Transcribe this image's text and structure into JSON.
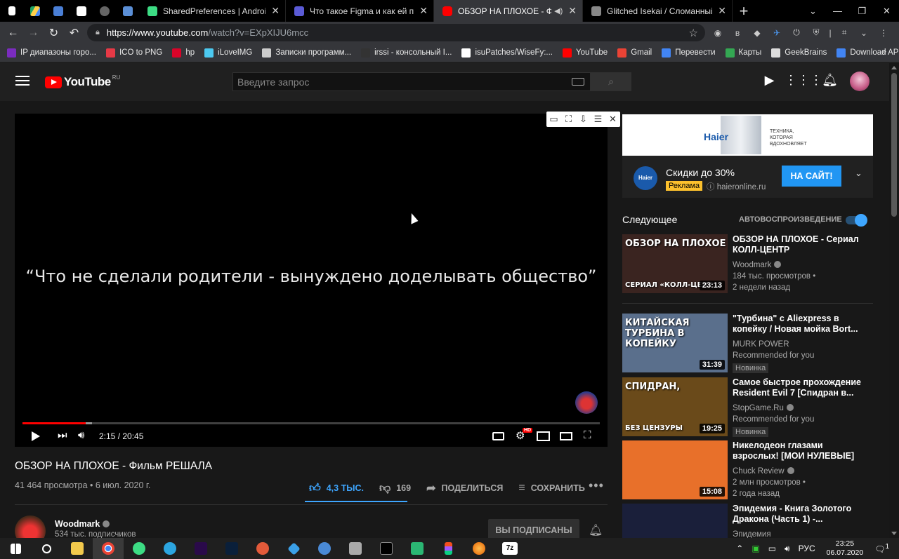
{
  "browser": {
    "tabs": [
      {
        "label": "SharedPreferences | Android De",
        "favicon_color": "#3ddc84",
        "active": false
      },
      {
        "label": "Что такое Figma и как ей польз",
        "favicon_color": "#5b5bd6",
        "active": false
      },
      {
        "label": "ОБЗОР НА ПЛОХОЕ - Филь",
        "favicon_color": "#ff0000",
        "active": true
      },
      {
        "label": "Glitched Isekai / Сломанный Ис",
        "favicon_color": "#888888",
        "active": false
      }
    ],
    "url_host": "https://www.youtube.com",
    "url_path": "/watch?v=EXpXIJU6mcc",
    "bookmarks": [
      {
        "label": "IP диапазоны горо...",
        "color": "#7b2cbf"
      },
      {
        "label": "ICO to PNG",
        "color": "#e63946"
      },
      {
        "label": "hp",
        "color": "#d90429"
      },
      {
        "label": "iLoveIMG",
        "color": "#4cc9f0"
      },
      {
        "label": "Записки программ...",
        "color": "#cccccc"
      },
      {
        "label": "irssi - консольный I...",
        "color": "#333333"
      },
      {
        "label": "isuPatches/WiseFy:...",
        "color": "#ffffff"
      },
      {
        "label": "YouTube",
        "color": "#ff0000"
      },
      {
        "label": "Gmail",
        "color": "#ea4335"
      },
      {
        "label": "Перевести",
        "color": "#4285f4"
      },
      {
        "label": "Карты",
        "color": "#34a853"
      },
      {
        "label": "GeekBrains",
        "color": "#dddddd"
      },
      {
        "label": "Download APK",
        "color": "#4285f4"
      }
    ]
  },
  "youtube": {
    "logo_text": "YouTube",
    "logo_region": "RU",
    "search_placeholder": "Введите запрос",
    "player": {
      "subtitle": "“Что не сделали родители - вынуждено доделывать общество”",
      "time": "2:15 / 20:45",
      "progress_fraction": 0.11,
      "hd_badge": "HD"
    },
    "video": {
      "title": "ОБЗОР НА ПЛОХОЕ - Фильм РЕШАЛА",
      "views_date": "41 464 просмотра • 6 июл. 2020 г.",
      "likes": "4,3 ТЫС.",
      "dislikes": "169",
      "share_label": "ПОДЕЛИТЬСЯ",
      "save_label": "СОХРАНИТЬ"
    },
    "channel": {
      "name": "Woodmark",
      "subs": "534 тыс. подписчиков",
      "subscribed_label": "ВЫ ПОДПИСАНЫ"
    },
    "ad": {
      "brand": "Haier",
      "banner_tagline": "ТЕХНИКА, КОТОРАЯ ВДОХНОВЛЯЕТ",
      "title": "Скидки до 30%",
      "badge": "Реклама",
      "domain": "haieronline.ru",
      "cta": "НА САЙТ!"
    },
    "upnext": {
      "label": "Следующее",
      "autoplay_label": "АВТОВОСПРОИЗВЕДЕНИЕ",
      "autoplay_on": true
    },
    "recommendations": [
      {
        "title": "ОБЗОР НА ПЛОХОЕ - Сериал КОЛЛ-ЦЕНТР",
        "channel": "Woodmark",
        "line2": "184 тыс. просмотров •",
        "line3": "2 недели назад",
        "duration": "23:13",
        "thumb_text": "ОБЗОР НА ПЛОХОЕ",
        "thumb_sub": "СЕРИАЛ «КОЛЛ-ЦЕНТ...",
        "thumb_color": "#3a2420",
        "badge": ""
      },
      {
        "title": "\"Турбина\" с Aliexpress в копейку / Новая мойка Bort...",
        "channel": "MURK POWER",
        "line2": "Recommended for you",
        "line3": "",
        "duration": "31:39",
        "thumb_text": "КИТАЙСКАЯ ТУРБИНА В КОПЕЙКУ",
        "thumb_sub": "",
        "thumb_color": "#5a6f8c",
        "badge": "Новинка"
      },
      {
        "title": "Самое быстрое прохождение Resident Evil 7 [Спидран в...",
        "channel": "StopGame.Ru",
        "line2": "Recommended for you",
        "line3": "",
        "duration": "19:25",
        "thumb_text": "СПИДРАН,",
        "thumb_sub": "БЕЗ ЦЕНЗУРЫ",
        "thumb_color": "#6a4a1a",
        "badge": "Новинка"
      },
      {
        "title": "Никелодеон глазами взрослых! [МОИ НУЛЕВЫЕ]",
        "channel": "Chuck Review",
        "line2": "2 млн просмотров •",
        "line3": "2 года назад",
        "duration": "15:08",
        "thumb_text": "",
        "thumb_sub": "",
        "thumb_color": "#e8702a",
        "badge": ""
      },
      {
        "title": "Эпидемия - Книга Золотого Дракона (Часть 1) -...",
        "channel": "Эпидемия",
        "line2": "",
        "line3": "",
        "duration": "",
        "thumb_text": "",
        "thumb_sub": "",
        "thumb_color": "#1a1f3a",
        "badge": ""
      }
    ]
  },
  "taskbar": {
    "language": "РУС",
    "time": "23:25",
    "date": "06.07.2020",
    "notification_count": "1"
  }
}
